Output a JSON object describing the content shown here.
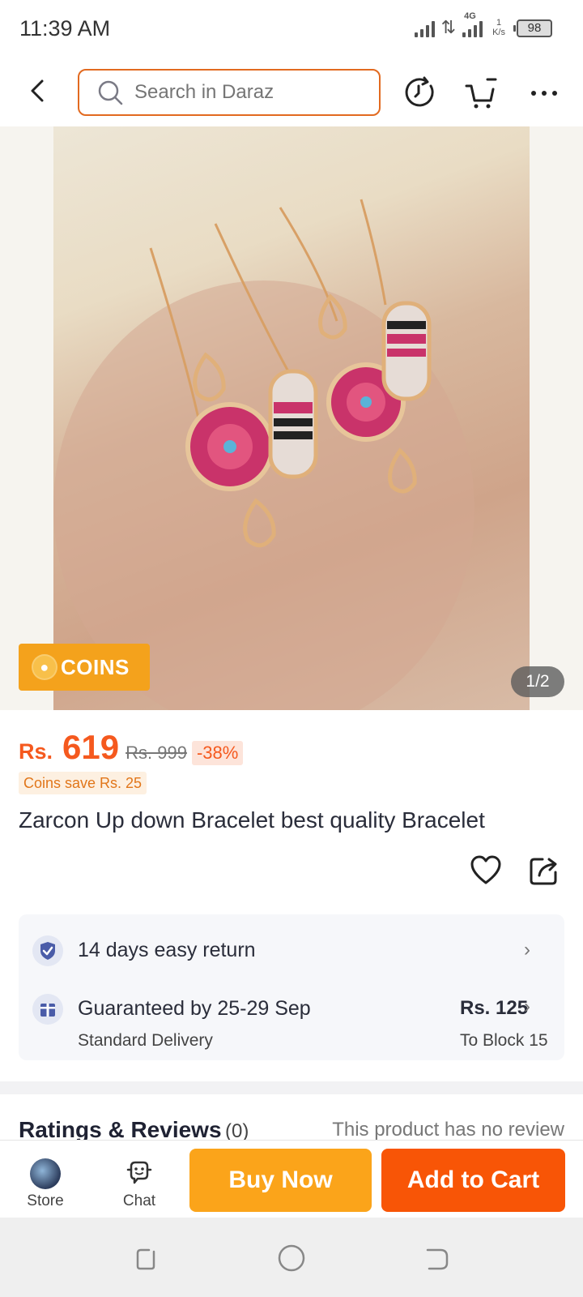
{
  "status_bar": {
    "time": "11:39 AM",
    "network": "4G",
    "speed_value": "1",
    "speed_unit": "K/s",
    "battery": "98"
  },
  "search": {
    "placeholder": "Search in Daraz"
  },
  "nav_icons": [
    "back-icon",
    "search-icon",
    "history-icon",
    "cart-icon",
    "more-icon"
  ],
  "gallery": {
    "badge_label": "COINS",
    "counter": "1/2"
  },
  "price": {
    "currency": "Rs.",
    "current": "619",
    "original": "Rs. 999",
    "discount": "-38%"
  },
  "coins_save": "Coins save Rs. 25",
  "product_title": "Zarcon Up down Bracelet best quality Bracelet",
  "services": {
    "return_label": "14 days easy return",
    "delivery_label": "Guaranteed by 25-29 Sep",
    "delivery_type": "Standard Delivery",
    "delivery_price": "Rs. 125",
    "delivery_destination": "To Block 15"
  },
  "ratings": {
    "title": "Ratings & Reviews",
    "count": "(0)",
    "note": "This product has no review"
  },
  "bottom_bar": {
    "store_label": "Store",
    "chat_label": "Chat",
    "buy_now_label": "Buy Now",
    "add_to_cart_label": "Add to Cart"
  },
  "colors": {
    "accent": "#f5591e",
    "buy_now": "#fba41a",
    "add_to_cart": "#f85506",
    "search_border": "#e26a20"
  }
}
